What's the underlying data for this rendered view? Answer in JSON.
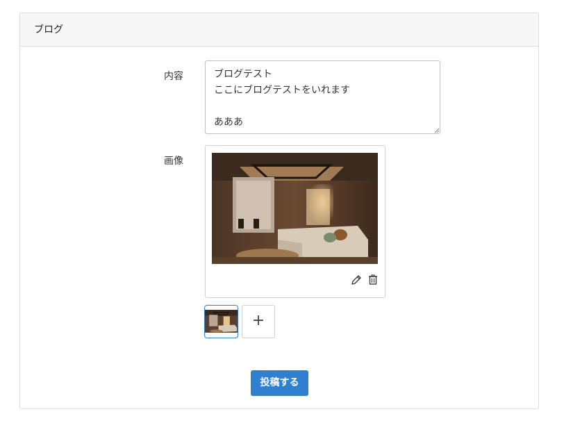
{
  "card": {
    "title": "ブログ"
  },
  "form": {
    "content_label": "内容",
    "content_value": "ブログテスト\nここにブログテストをいれます\n\nあああ",
    "image_label": "画像",
    "add_label": "+",
    "submit_label": "投稿する"
  },
  "icons": {
    "edit": "pencil-icon",
    "delete": "trash-icon",
    "add": "plus-icon"
  },
  "colors": {
    "primary": "#2f80d1",
    "selected_border": "#2f7fcf"
  }
}
